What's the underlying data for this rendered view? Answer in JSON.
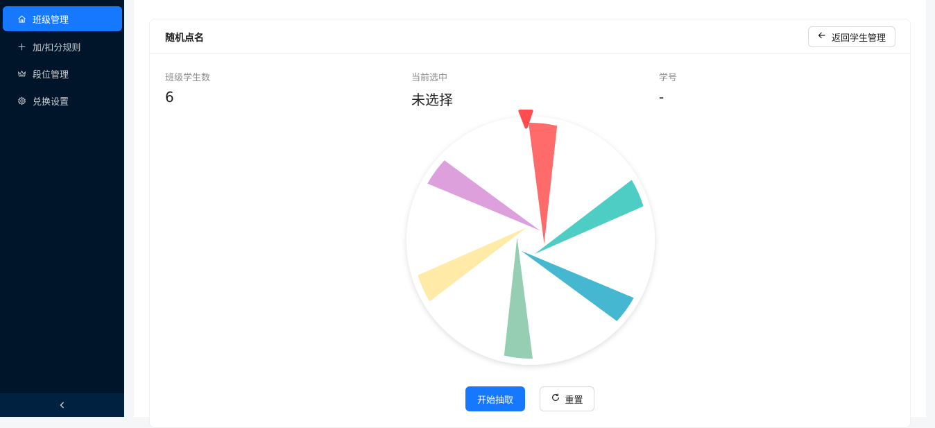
{
  "sidebar": {
    "items": [
      {
        "label": "班级管理",
        "icon": "home-icon",
        "active": true
      },
      {
        "label": "加/扣分规则",
        "icon": "plus-icon",
        "active": false
      },
      {
        "label": "段位管理",
        "icon": "crown-icon",
        "active": false
      },
      {
        "label": "兑换设置",
        "icon": "gear-icon",
        "active": false
      }
    ],
    "collapse_icon": "chevron-left-icon"
  },
  "card": {
    "title": "随机点名",
    "back_label": "返回学生管理"
  },
  "stats": {
    "count_label": "班级学生数",
    "count_value": "6",
    "current_label": "当前选中",
    "current_value": "未选择",
    "id_label": "学号",
    "id_value": "-"
  },
  "wheel": {
    "segment_count": 6,
    "colors": [
      "#ff6b6b",
      "#4ecdc4",
      "#45b7d1",
      "#96ceb4",
      "#ffeaa7",
      "#dda0dd"
    ],
    "pointer_color": "#ff4d4f"
  },
  "actions": {
    "start_label": "开始抽取",
    "reset_label": "重置"
  }
}
